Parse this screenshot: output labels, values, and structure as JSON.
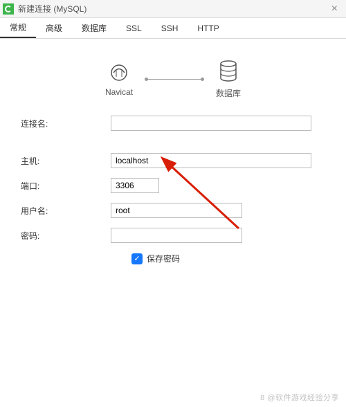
{
  "titlebar": {
    "title": "新建连接 (MySQL)"
  },
  "tabs": [
    {
      "label": "常规",
      "active": true
    },
    {
      "label": "高级"
    },
    {
      "label": "数据库"
    },
    {
      "label": "SSL"
    },
    {
      "label": "SSH"
    },
    {
      "label": "HTTP"
    }
  ],
  "hero": {
    "left_label": "Navicat",
    "right_label": "数据库"
  },
  "form": {
    "conn_name_label": "连接名:",
    "conn_name_value": "",
    "host_label": "主机:",
    "host_value": "localhost",
    "port_label": "端口:",
    "port_value": "3306",
    "user_label": "用户名:",
    "user_value": "root",
    "pass_label": "密码:",
    "pass_value": "",
    "save_pass_label": "保存密码",
    "save_pass_checked": true
  },
  "watermark": "8 @软件游戏经验分享"
}
